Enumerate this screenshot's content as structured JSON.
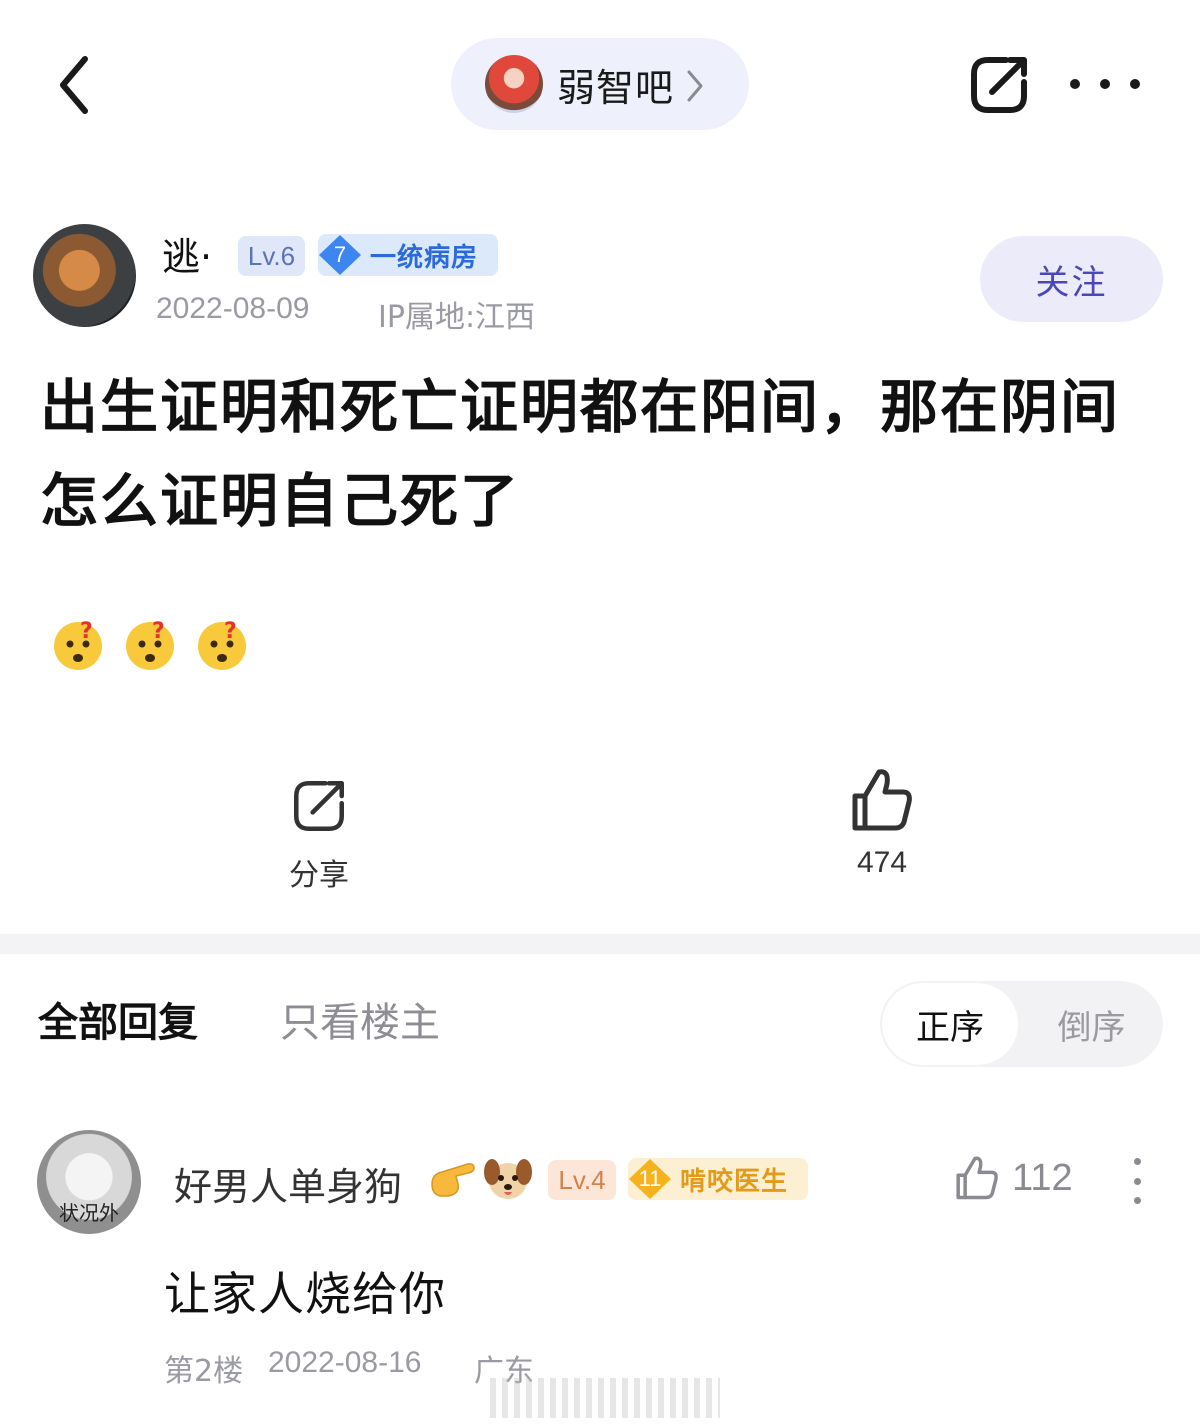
{
  "header": {
    "forum_name": "弱智吧",
    "forum_chevron": "›"
  },
  "post": {
    "author_name": "逃·",
    "level": "Lv.6",
    "title_badge_num": "7",
    "title_badge_text": "一统病房",
    "date": "2022-08-09",
    "ip": "IP属地:江西",
    "follow_label": "关注",
    "title": "出生证明和死亡证明都在阳间，那在阴间怎么证明自己死了",
    "emojis": [
      "thinking-face",
      "thinking-face",
      "thinking-face"
    ],
    "share_label": "分享",
    "like_count": "474"
  },
  "tabs": {
    "all": "全部回复",
    "owner_only": "只看楼主",
    "sort_asc": "正序",
    "sort_desc": "倒序"
  },
  "reply": {
    "author_name": "好男人单身狗",
    "avatar_caption": "状况外",
    "emojis": [
      "pointing-hand",
      "dog-face"
    ],
    "level": "Lv.4",
    "title_badge_num": "11",
    "title_badge_text": "啃咬医生",
    "like_count": "112",
    "content": "让家人烧给你",
    "floor": "第2楼",
    "date": "2022-08-16",
    "location": "广东"
  },
  "colors": {
    "accent_purple": "#4a48b8",
    "badge_blue": "#2d6ad9",
    "badge_orange": "#e29a1a",
    "muted": "#9a9aa2"
  }
}
